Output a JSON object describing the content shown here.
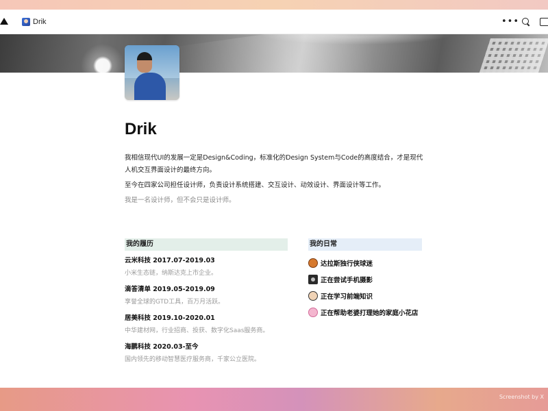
{
  "app": {
    "tab_label": "Drik"
  },
  "toolbar": {
    "more_label": "•••"
  },
  "page": {
    "title": "Drik",
    "intro": [
      "我相信现代UI的发展一定是Design&Coding，标准化的Design System与Code的高度结合，才是现代人机交互界面设计的最终方向。",
      "至今在四家公司担任设计师，负责设计系统搭建、交互设计、动效设计、界面设计等工作。",
      "我是一名设计师，但不会只是设计师。"
    ],
    "resume": {
      "header": "我的履历",
      "items": [
        {
          "title": "云米科技 2017.07-2019.03",
          "desc": "小米生态链，纳斯达克上市企业。"
        },
        {
          "title": "滴答清单 2019.05-2019.09",
          "desc": "享誉全球的GTD工具，百万月活跃。"
        },
        {
          "title": "居美科技 2019.10-2020.01",
          "desc": "中华建材网，行业招商、投获、数字化Saas服务商。"
        },
        {
          "title": "海鹏科技 2020.03-至今",
          "desc": "国内领先的移动智慧医疗服务商，千家公立医院。"
        }
      ]
    },
    "daily": {
      "header": "我的日常",
      "items": [
        {
          "icon": "basketball-icon",
          "label": "达拉斯独行侠球迷"
        },
        {
          "icon": "camera-icon",
          "label": "正在尝试手机摄影"
        },
        {
          "icon": "coder-icon",
          "label": "正在学习前端知识"
        },
        {
          "icon": "flower-icon",
          "label": "正在帮助老婆打理她的家庭小花店"
        }
      ]
    }
  },
  "footer": {
    "watermark": "Screenshot by X"
  },
  "colors": {
    "resume_header_bg": "#e3efe9",
    "daily_header_bg": "#e5eef8",
    "muted_text": "#9a9a9a"
  }
}
